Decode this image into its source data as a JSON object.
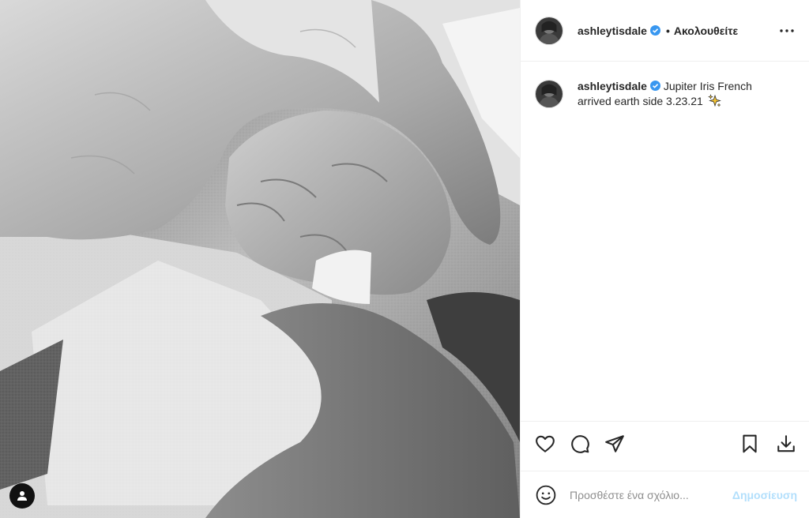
{
  "post": {
    "username": "ashleytisdale",
    "follow_label": "Ακολουθείτε",
    "separator": "•",
    "caption": "Jupiter Iris French arrived earth side 3.23.21",
    "caption_emoji": "sparkles-icon"
  },
  "actions": {
    "icons": [
      "heart-icon",
      "comment-icon",
      "share-icon",
      "bookmark-icon",
      "download-icon"
    ]
  },
  "comment": {
    "placeholder": "Προσθέστε ένα σχόλιο...",
    "post_label": "Δημοσίευση"
  },
  "colors": {
    "verified": "#3897f0",
    "post_button_disabled": "#b2dffc",
    "border": "#efefef"
  }
}
